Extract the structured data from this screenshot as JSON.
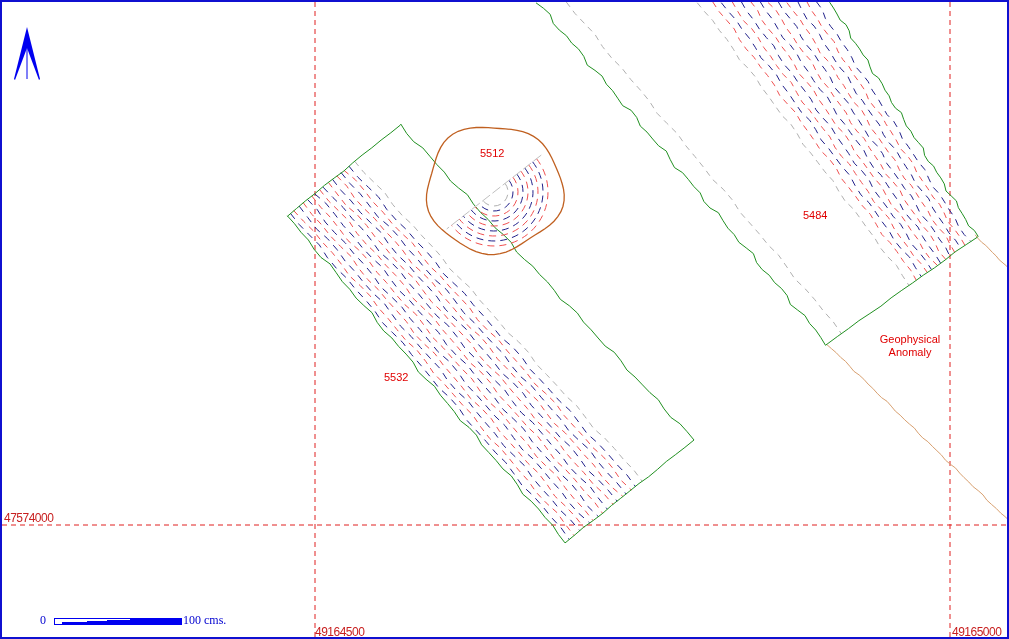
{
  "features": [
    {
      "label": "5512"
    },
    {
      "label": "5484"
    },
    {
      "label": "5532"
    }
  ],
  "annotation": "Geophysical Anomaly",
  "grid_labels": [
    "47574000",
    "49164500",
    "49165000"
  ],
  "scale_bar": {
    "start": "0",
    "end": "100 cms."
  }
}
